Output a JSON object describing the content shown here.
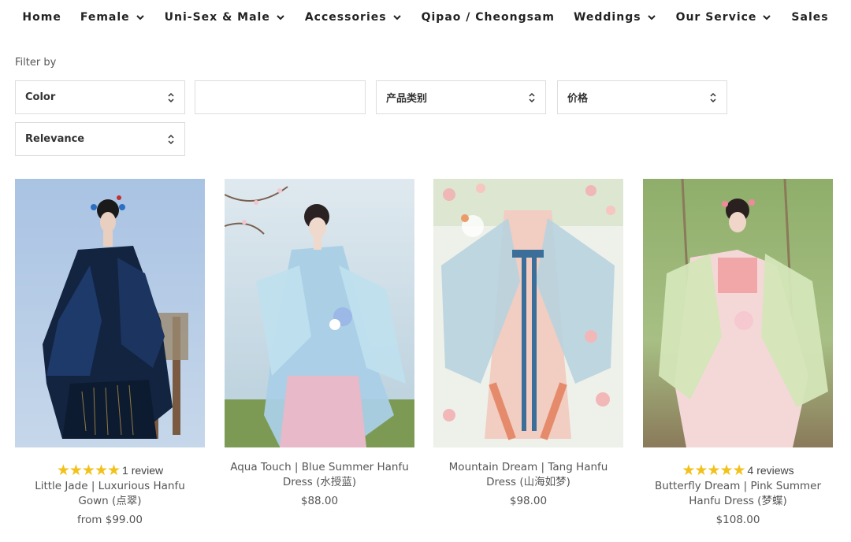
{
  "nav": {
    "items": [
      {
        "label": "Home",
        "has_dropdown": false
      },
      {
        "label": "Female",
        "has_dropdown": true
      },
      {
        "label": "Uni-Sex & Male",
        "has_dropdown": true
      },
      {
        "label": "Accessories",
        "has_dropdown": true
      },
      {
        "label": "Qipao / Cheongsam",
        "has_dropdown": false
      },
      {
        "label": "Weddings",
        "has_dropdown": true
      },
      {
        "label": "Our Service",
        "has_dropdown": true
      },
      {
        "label": "Sales",
        "has_dropdown": false
      }
    ]
  },
  "filter": {
    "label": "Filter by",
    "color_select": "Color",
    "blank_select": "",
    "category_select": "产品类别",
    "price_select": "价格",
    "sort_select": "Relevance"
  },
  "products": [
    {
      "rating": 5,
      "review_text": "1 review",
      "title": "Little Jade | Luxurious Hanfu Gown (点翠)",
      "price": "from $99.00",
      "image_icon": "product-photo-dark-blue-gown"
    },
    {
      "rating": null,
      "review_text": "",
      "title": "Aqua Touch | Blue Summer Hanfu Dress (水授蓝)",
      "price": "$88.00",
      "image_icon": "product-photo-blue-dress"
    },
    {
      "rating": null,
      "review_text": "",
      "title": "Mountain Dream | Tang Hanfu Dress (山海如梦)",
      "price": "$98.00",
      "image_icon": "product-photo-tang-dress"
    },
    {
      "rating": 5,
      "review_text": "4 reviews",
      "title": "Butterfly Dream | Pink Summer Hanfu Dress (梦蝶)",
      "price": "$108.00",
      "image_icon": "product-photo-pink-dress"
    }
  ],
  "colors": {
    "star": "#f2c11a",
    "text": "#555555",
    "border": "#dddddd"
  }
}
